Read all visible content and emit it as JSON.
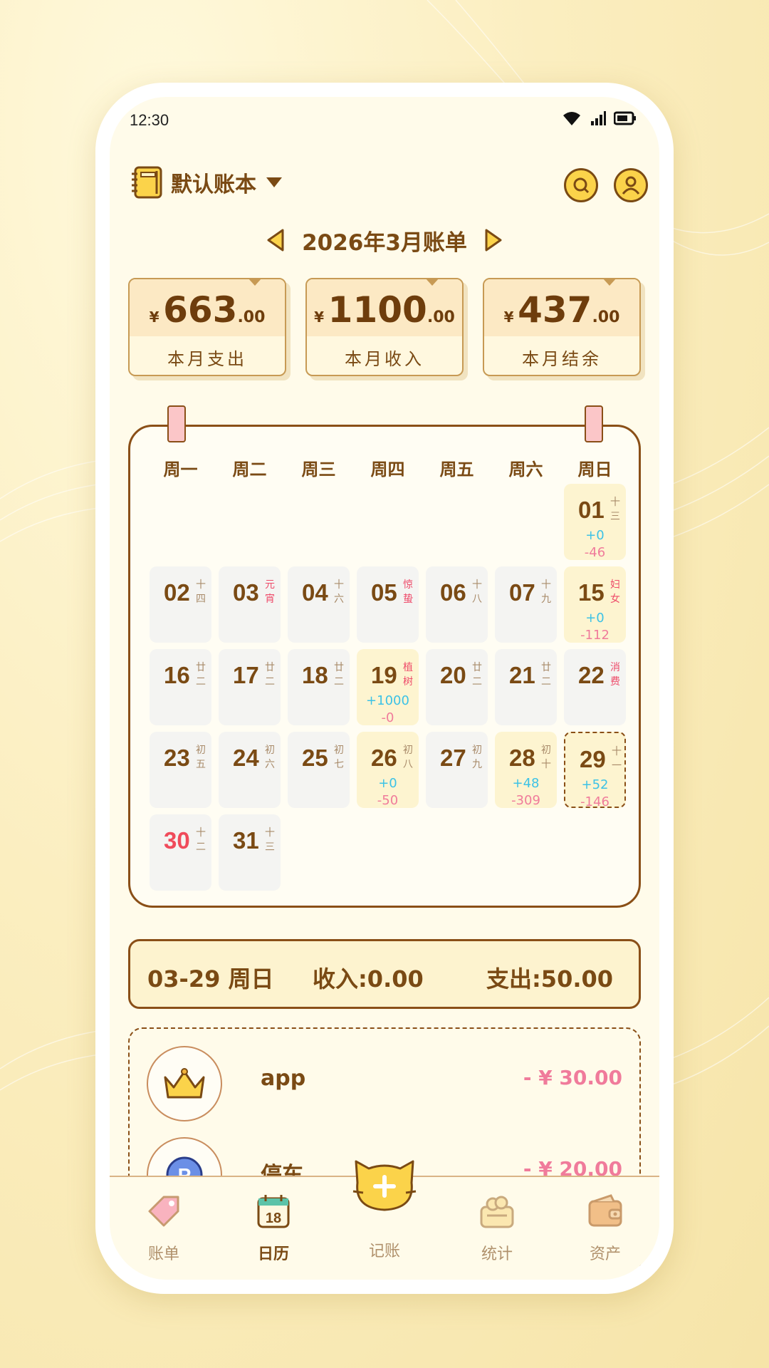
{
  "status_bar": {
    "time": "12:30"
  },
  "header": {
    "book_title": "默认账本"
  },
  "month_nav": {
    "title": "2026年3月账单"
  },
  "summary": {
    "expense": {
      "currency": "¥",
      "amount": "663",
      "decimals": ".00",
      "label": "本月支出"
    },
    "income": {
      "currency": "¥",
      "amount": "1100",
      "decimals": ".00",
      "label": "本月收入"
    },
    "balance": {
      "currency": "¥",
      "amount": "437",
      "decimals": ".00",
      "label": "本月结余"
    }
  },
  "calendar": {
    "weekdays": [
      "周一",
      "周二",
      "周三",
      "周四",
      "周五",
      "周六",
      "周日"
    ],
    "days": [
      {
        "day": "01",
        "lunar": "十三",
        "inc": "+0",
        "exp": "-46",
        "has": true
      },
      {
        "day": "02",
        "lunar": "十四"
      },
      {
        "day": "03",
        "lunar": "元宵",
        "festival": true
      },
      {
        "day": "04",
        "lunar": "十六"
      },
      {
        "day": "05",
        "lunar": "惊蛰",
        "festival": true
      },
      {
        "day": "06",
        "lunar": "十八"
      },
      {
        "day": "07",
        "lunar": "十九"
      },
      {
        "day": "15",
        "lunar": "妇女",
        "festival": true,
        "inc": "+0",
        "exp": "-112",
        "has": true
      },
      {
        "day": "16",
        "lunar": "廿二"
      },
      {
        "day": "17",
        "lunar": "廿二"
      },
      {
        "day": "18",
        "lunar": "廿二"
      },
      {
        "day": "19",
        "lunar": "植树",
        "festival": true,
        "inc": "+1000",
        "exp": "-0",
        "has": true
      },
      {
        "day": "20",
        "lunar": "廿二"
      },
      {
        "day": "21",
        "lunar": "廿二"
      },
      {
        "day": "22",
        "lunar": "消费",
        "festival": true
      },
      {
        "day": "23",
        "lunar": "初五"
      },
      {
        "day": "24",
        "lunar": "初六"
      },
      {
        "day": "25",
        "lunar": "初七"
      },
      {
        "day": "26",
        "lunar": "初八",
        "inc": "+0",
        "exp": "-50",
        "has": true
      },
      {
        "day": "27",
        "lunar": "初九"
      },
      {
        "day": "28",
        "lunar": "初十",
        "inc": "+48",
        "exp": "-309",
        "has": true
      },
      {
        "day": "29",
        "lunar": "十一",
        "inc": "+52",
        "exp": "-146",
        "selected": true
      },
      {
        "day": "30",
        "lunar": "十二",
        "today": true
      },
      {
        "day": "31",
        "lunar": "十三"
      }
    ]
  },
  "day_summary": {
    "date": "03-29 周日",
    "income": "收入:0.00",
    "expense": "支出:50.00"
  },
  "records": [
    {
      "icon": "crown-icon",
      "name": "app",
      "amount": "- ¥ 30.00"
    },
    {
      "icon": "parking-icon",
      "name": "停车",
      "amount": "- ¥ 20.00"
    }
  ],
  "tabbar": {
    "tabs": [
      {
        "label": "账单",
        "icon": "tag-icon"
      },
      {
        "label": "日历",
        "icon": "calendar-icon",
        "badge": "18",
        "active": true
      },
      {
        "label": "记账",
        "icon": "cat-add-icon"
      },
      {
        "label": "统计",
        "icon": "stats-icon"
      },
      {
        "label": "资产",
        "icon": "wallet-icon"
      }
    ]
  }
}
